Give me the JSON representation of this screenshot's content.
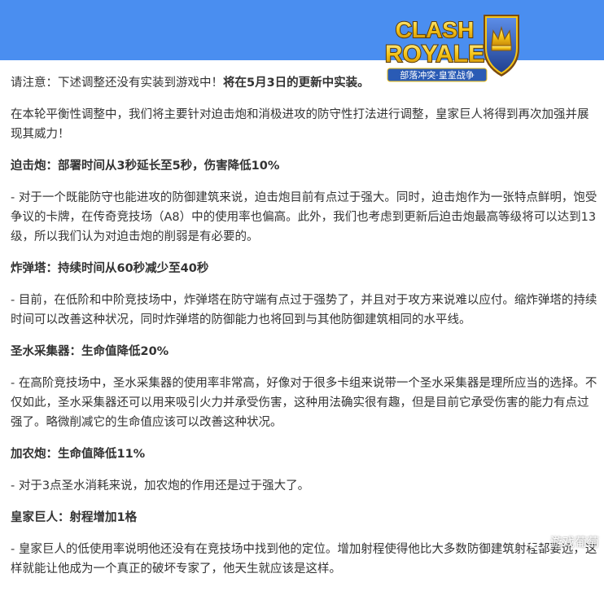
{
  "logo": {
    "title_line1": "CLASH",
    "title_line2": "ROYALE",
    "subtitle": "部落冲突·皇室战争"
  },
  "intro": {
    "notice_prefix": "请注意：下述调整还没有实装到游戏中！",
    "notice_bold": "将在5月3日的更新中实装。",
    "paragraph": "在本轮平衡性调整中，我们将主要针对迫击炮和消极进攻的防守性打法进行调整，皇家巨人将得到再次加强并展现其威力！"
  },
  "sections": [
    {
      "heading": "迫击炮：部署时间从3秒延长至5秒，伤害降低10%",
      "body": "- 对于一个既能防守也能进攻的防御建筑来说，迫击炮目前有点过于强大。同时，迫击炮作为一张特点鲜明，饱受争议的卡牌，在传奇竞技场（A8）中的使用率也偏高。此外，我们也考虑到更新后迫击炮最高等级将可以达到13级，所以我们认为对迫击炮的削弱是有必要的。"
    },
    {
      "heading": "炸弹塔：持续时间从60秒减少至40秒",
      "body": "- 目前，在低阶和中阶竞技场中，炸弹塔在防守端有点过于强势了，并且对于攻方来说难以应付。缩炸弹塔的持续时间可以改善这种状况，同时炸弹塔的防御能力也将回到与其他防御建筑相同的水平线。"
    },
    {
      "heading": "圣水采集器：生命值降低20%",
      "body": "- 在高阶竞技场中，圣水采集器的使用率非常高，好像对于很多卡组来说带一个圣水采集器是理所应当的选择。不仅如此，圣水采集器还可以用来吸引火力并承受伤害，这种用法确实很有趣，但是目前它承受伤害的能力有点过强了。略微削减它的生命值应该可以改善这种状况。"
    },
    {
      "heading": "加农炮：生命值降低11%",
      "body": "- 对于3点圣水消耗来说，加农炮的作用还是过于强大了。"
    },
    {
      "heading": "皇家巨人：射程增加1格",
      "body": "- 皇家巨人的低使用率说明他还没有在竞技场中找到他的定位。增加射程使得他比大多数防御建筑射程都要远，这样就能让他成为一个真正的破坏专家了，他天生就应该是这样。"
    }
  ],
  "watermark": {
    "text": "游戏葡萄",
    "icon": "wechat-icon"
  },
  "colors": {
    "banner": "#4a8ef0",
    "text": "#333333",
    "logo_gold": "#f5c518",
    "logo_blue": "#2a5bb5"
  }
}
